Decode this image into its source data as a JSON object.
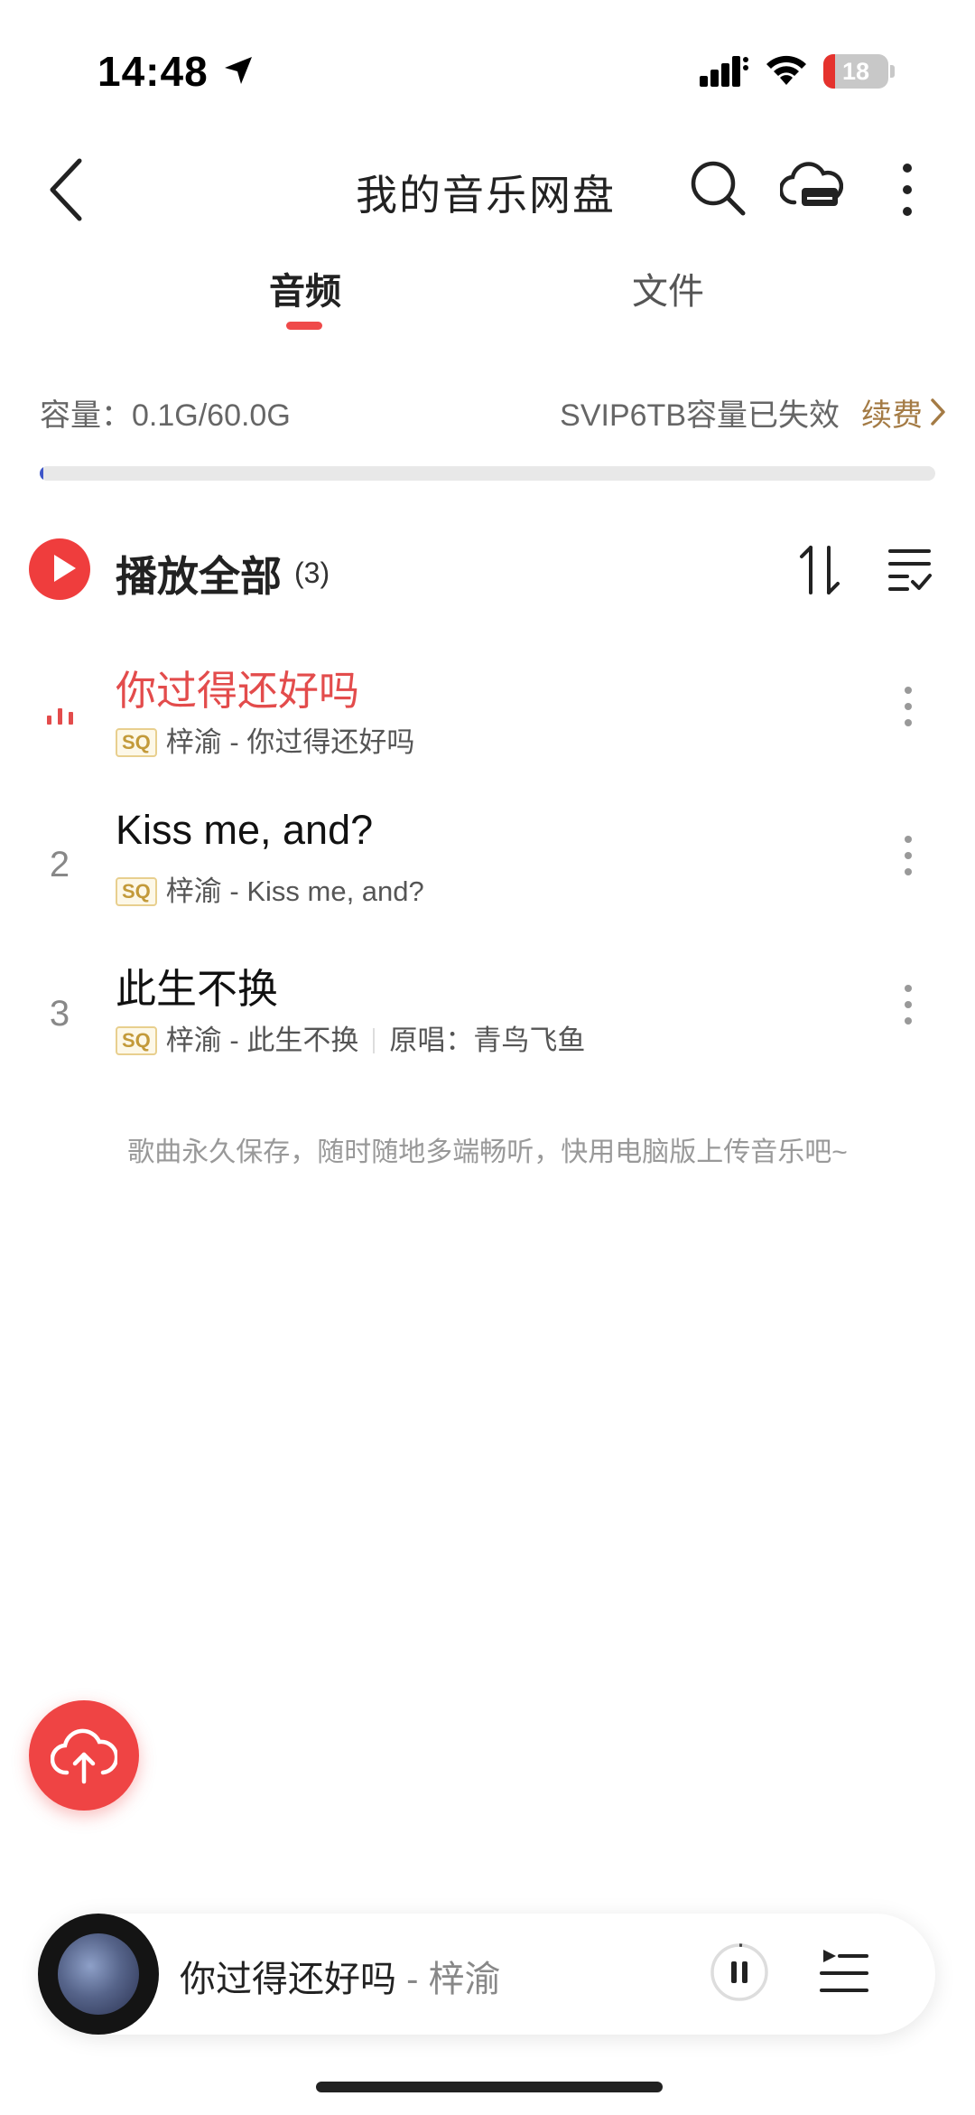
{
  "status_bar": {
    "time": "14:48",
    "battery_level": "18",
    "battery_color": "#e5322d"
  },
  "header": {
    "title": "我的音乐网盘",
    "back_icon": "chevron-left-icon",
    "search_icon": "search-icon",
    "cloud_icon": "cloud-drive-icon",
    "more_icon": "more-vertical-icon"
  },
  "tabs": [
    {
      "label": "音频",
      "active": true
    },
    {
      "label": "文件",
      "active": false
    }
  ],
  "capacity": {
    "usage": "容量：0.1G/60.0G",
    "notice": "SVIP6TB容量已失效",
    "renew_label": "续费",
    "used_fraction": 0.0017
  },
  "play_all": {
    "label": "播放全部",
    "count": "(3)"
  },
  "songs": [
    {
      "index": "",
      "title": "你过得还好吗",
      "quality": "SQ",
      "subtitle": "梓渝 - 你过得还好吗",
      "original": "",
      "playing": true
    },
    {
      "index": "2",
      "title": "Kiss me, and?",
      "quality": "SQ",
      "subtitle": "梓渝 - Kiss me, and?",
      "original": "",
      "playing": false
    },
    {
      "index": "3",
      "title": "此生不换",
      "quality": "SQ",
      "subtitle": "梓渝 - 此生不换",
      "original": "原唱：青鸟飞鱼",
      "playing": false
    }
  ],
  "tip": "歌曲永久保存，随时随地多端畅听，快用电脑版上传音乐吧~",
  "mini_player": {
    "title": "你过得还好吗",
    "artist": " - 梓渝"
  },
  "colors": {
    "accent": "#ef4444",
    "playing_text": "#e34c4c",
    "renew": "#a47b45",
    "progress": "#3e56c9"
  }
}
